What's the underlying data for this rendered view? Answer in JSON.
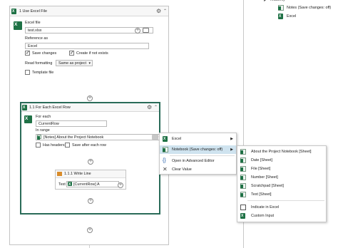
{
  "colors": {
    "excel_green": "#1e7145",
    "selected_border": "#2a6b58",
    "highlight": "#cfe3ef",
    "accent_red": "#c62828"
  },
  "tree": {
    "parent_label": "readonly",
    "items": [
      {
        "label": "Notes (Save changes: off)",
        "icon": "excel-sheet-icon"
      },
      {
        "label": "Excel",
        "icon": "excel-icon"
      }
    ]
  },
  "use_excel": {
    "title": "1 Use Excel File",
    "excel_file_label": "Excel file",
    "excel_file_value": "test.xlsx",
    "reference_label": "Reference as",
    "reference_value": "Excel",
    "save_changes_label": "Save changes",
    "save_changes_checked": true,
    "create_label": "Create if not exists",
    "create_checked": true,
    "read_formatting_label": "Read formatting",
    "read_formatting_value": "Same as project",
    "template_label": "Template file",
    "template_checked": false
  },
  "for_each": {
    "title": "1.1 For Each Excel Row",
    "for_each_label": "For each",
    "for_each_value": "CurrentRow",
    "in_range_label": "In range",
    "in_range_value": "[Notes] About the Project Notebook",
    "has_headers_label": "Has headers",
    "has_headers_checked": false,
    "save_after_label": "Save after each row",
    "save_after_checked": false
  },
  "write_line": {
    "title": "1.1.1 Write Line",
    "text_label": "Text",
    "text_value": "[CurrentRow] A"
  },
  "context_menu": {
    "items": [
      {
        "label": "Excel",
        "icon": "excel-icon",
        "submenu": true
      },
      {
        "label": "Notebook (Save changes: off)",
        "icon": "notebook-icon",
        "submenu": true,
        "highlighted": true
      },
      {
        "label": "Open in Advanced Editor",
        "icon": "braces-icon"
      },
      {
        "label": "Clear Value",
        "icon": "x-icon"
      }
    ]
  },
  "submenu": {
    "items": [
      {
        "label": "About the Project Notebook [Sheet]"
      },
      {
        "label": "Date [Sheet]"
      },
      {
        "label": "File [Sheet]"
      },
      {
        "label": "Number [Sheet]"
      },
      {
        "label": "Scratchpad [Sheet]"
      },
      {
        "label": "Text [Sheet]"
      },
      {
        "label": "Indicate in Excel"
      },
      {
        "label": "Custom Input"
      }
    ]
  }
}
